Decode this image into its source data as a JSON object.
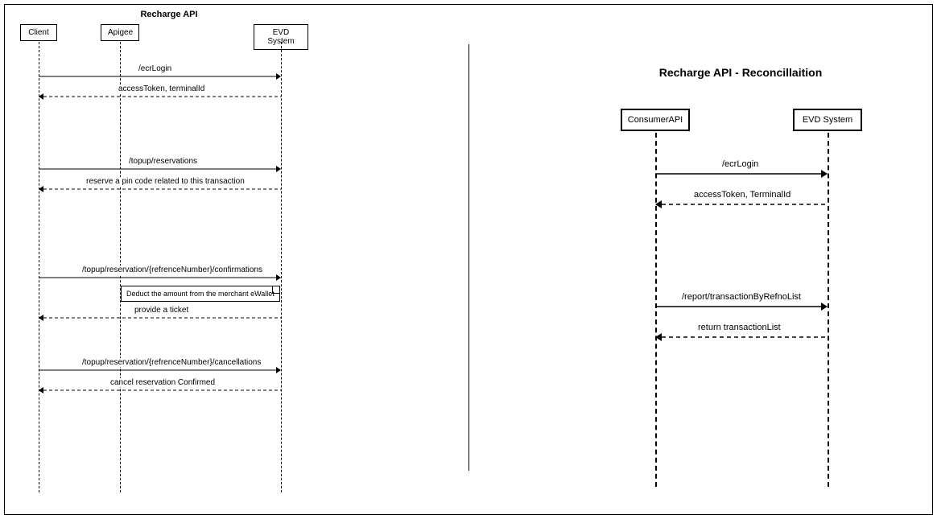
{
  "left": {
    "title": "Recharge API",
    "participants": [
      "Client",
      "Apigee",
      "EVD System"
    ],
    "messages": [
      {
        "label": "/ecrLogin",
        "from": 0,
        "to": 2,
        "dashed": false
      },
      {
        "label": "accessToken, terminalId",
        "from": 2,
        "to": 0,
        "dashed": true
      },
      {
        "label": "/topup/reservations",
        "from": 0,
        "to": 2,
        "dashed": false
      },
      {
        "label": "reserve a pin code related to this transaction",
        "from": 2,
        "to": 0,
        "dashed": true
      },
      {
        "label": "/topup/reservation/{refrenceNumber}/confirmations",
        "from": 0,
        "to": 2,
        "dashed": false
      },
      {
        "label": "provide a ticket",
        "from": 2,
        "to": 0,
        "dashed": true
      },
      {
        "label": "/topup/reservation/{refrenceNumber}/cancellations",
        "from": 0,
        "to": 2,
        "dashed": false
      },
      {
        "label": "cancel reservation Confirmed",
        "from": 2,
        "to": 0,
        "dashed": true
      }
    ],
    "note": "Deduct the amount from the merchant eWallet"
  },
  "right": {
    "title": "Recharge API - Reconcillaition",
    "participants": [
      "ConsumerAPI",
      "EVD System"
    ],
    "messages": [
      {
        "label": "/ecrLogin",
        "from": 0,
        "to": 1,
        "dashed": false
      },
      {
        "label": "accessToken, TerminalId",
        "from": 1,
        "to": 0,
        "dashed": true
      },
      {
        "label": "/report/transactionByRefnoList",
        "from": 0,
        "to": 1,
        "dashed": false
      },
      {
        "label": "return transactionList",
        "from": 1,
        "to": 0,
        "dashed": true
      }
    ]
  }
}
